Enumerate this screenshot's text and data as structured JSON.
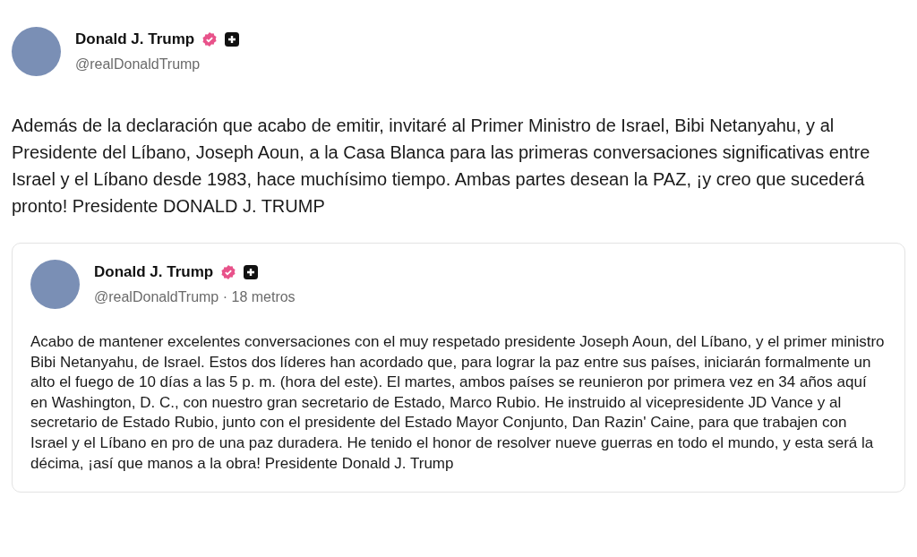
{
  "post": {
    "author": {
      "name": "Donald J. Trump",
      "handle": "@realDonaldTrump",
      "verified": true
    },
    "text": "Además de la declaración que acabo de emitir, invitaré al Primer Ministro de Israel, Bibi Netanyahu, y al Presidente del Líbano, Joseph Aoun, a la Casa Blanca para las primeras conversaciones significativas entre Israel y el Líbano desde 1983, hace muchísimo tiempo. Ambas partes desean la PAZ, ¡y creo que sucederá pronto! Presidente DONALD J. TRUMP"
  },
  "quoted_post": {
    "author": {
      "name": "Donald J. Trump",
      "handle": "@realDonaldTrump",
      "verified": true
    },
    "separator": "·",
    "time": "18 metros",
    "text": "Acabo de mantener excelentes conversaciones con el muy respetado presidente Joseph Aoun, del Líbano, y el primer ministro Bibi Netanyahu, de Israel. Estos dos líderes han acordado que, para lograr la paz entre sus países, iniciarán formalmente un alto el fuego de 10 días a las 5 p. m. (hora del este). El martes, ambos países se reunieron por primera vez en 34 años aquí en Washington, D. C., con nuestro gran secretario de Estado, Marco Rubio. He instruido al vicepresidente JD Vance y al secretario de Estado Rubio, junto con el presidente del Estado Mayor Conjunto, Dan Razin' Caine, para que trabajen con Israel y el Líbano en pro de una paz duradera. He tenido el honor de resolver nueve guerras en todo el mundo, y esta será la décima, ¡así que manos a la obra! Presidente Donald J. Trump"
  }
}
